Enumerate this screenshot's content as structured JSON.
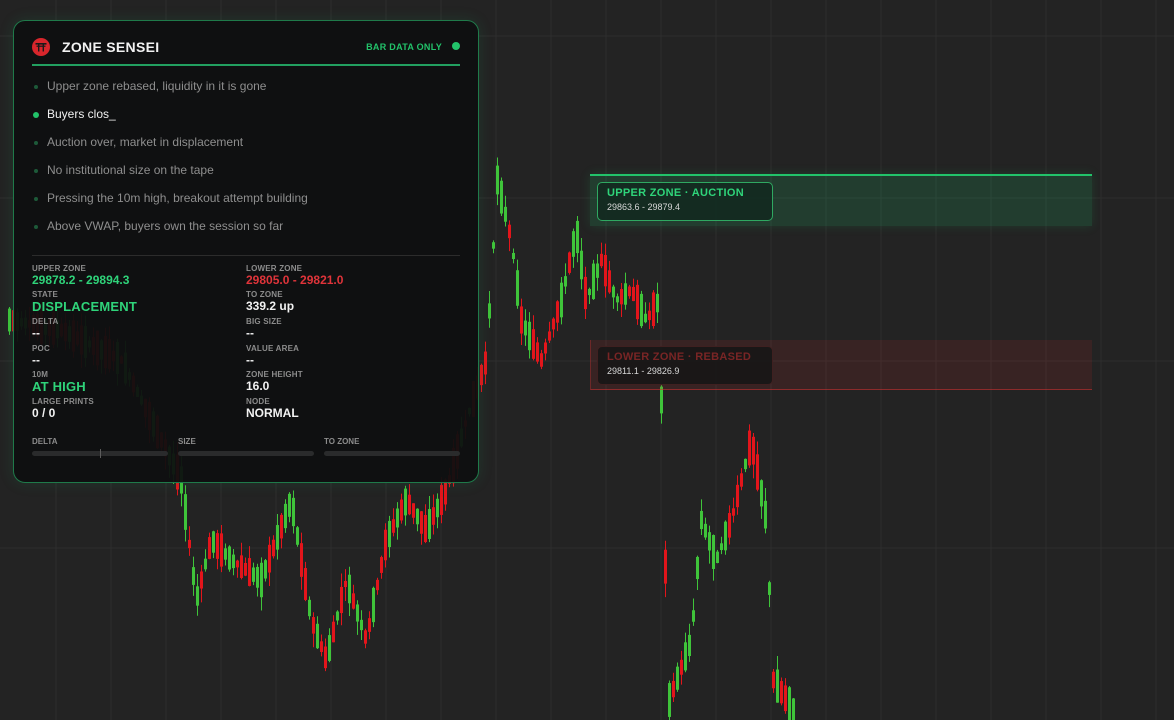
{
  "panel": {
    "title": "ZONE SENSEI",
    "data_mode": "BAR DATA ONLY",
    "status_color": "#22c36a",
    "messages": [
      {
        "text": "Upper zone rebased, liquidity in it is gone",
        "active": false
      },
      {
        "text": "Buyers clos_",
        "active": true
      },
      {
        "text": "Auction over, market in displacement",
        "active": false
      },
      {
        "text": "No institutional size on the tape",
        "active": false
      },
      {
        "text": "Pressing the 10m high, breakout attempt building",
        "active": false
      },
      {
        "text": "Above VWAP, buyers own the session so far",
        "active": false
      }
    ],
    "stats": {
      "upper_zone_label": "UPPER ZONE",
      "upper_zone_value": "29878.2 - 29894.3",
      "lower_zone_label": "LOWER ZONE",
      "lower_zone_value": "29805.0 - 29821.0",
      "state_label": "STATE",
      "state_value": "DISPLACEMENT",
      "to_zone_label": "TO ZONE",
      "to_zone_value": "339.2  up",
      "delta_label": "DELTA",
      "delta_value": "--",
      "big_size_label": "BIG SIZE",
      "big_size_value": "--",
      "poc_label": "POC",
      "poc_value": "--",
      "value_area_label": "VALUE AREA",
      "value_area_value": "--",
      "tenm_label": "10M",
      "tenm_value": "AT HIGH",
      "zone_height_label": "ZONE HEIGHT",
      "zone_height_value": "16.0",
      "large_prints_label": "LARGE PRINTS",
      "large_prints_value": "0  /  0",
      "node_label": "NODE",
      "node_value": "NORMAL"
    },
    "bars": {
      "delta_label": "DELTA",
      "size_label": "SIZE",
      "to_zone_label": "TO ZONE",
      "delta_level": 0.5,
      "size_level": 0,
      "to_zone_level": 0
    }
  },
  "chart": {
    "upper_zone": {
      "title": "UPPER ZONE  ·  AUCTION",
      "range": "29863.6  -  29879.4"
    },
    "lower_zone": {
      "title": "LOWER ZONE  ·  REBASED",
      "range": "29811.1  -  29826.9"
    },
    "colors": {
      "up": "#3fc43a",
      "down": "#e3151b",
      "background": "#232323",
      "grid": "#2e2e2e"
    }
  }
}
